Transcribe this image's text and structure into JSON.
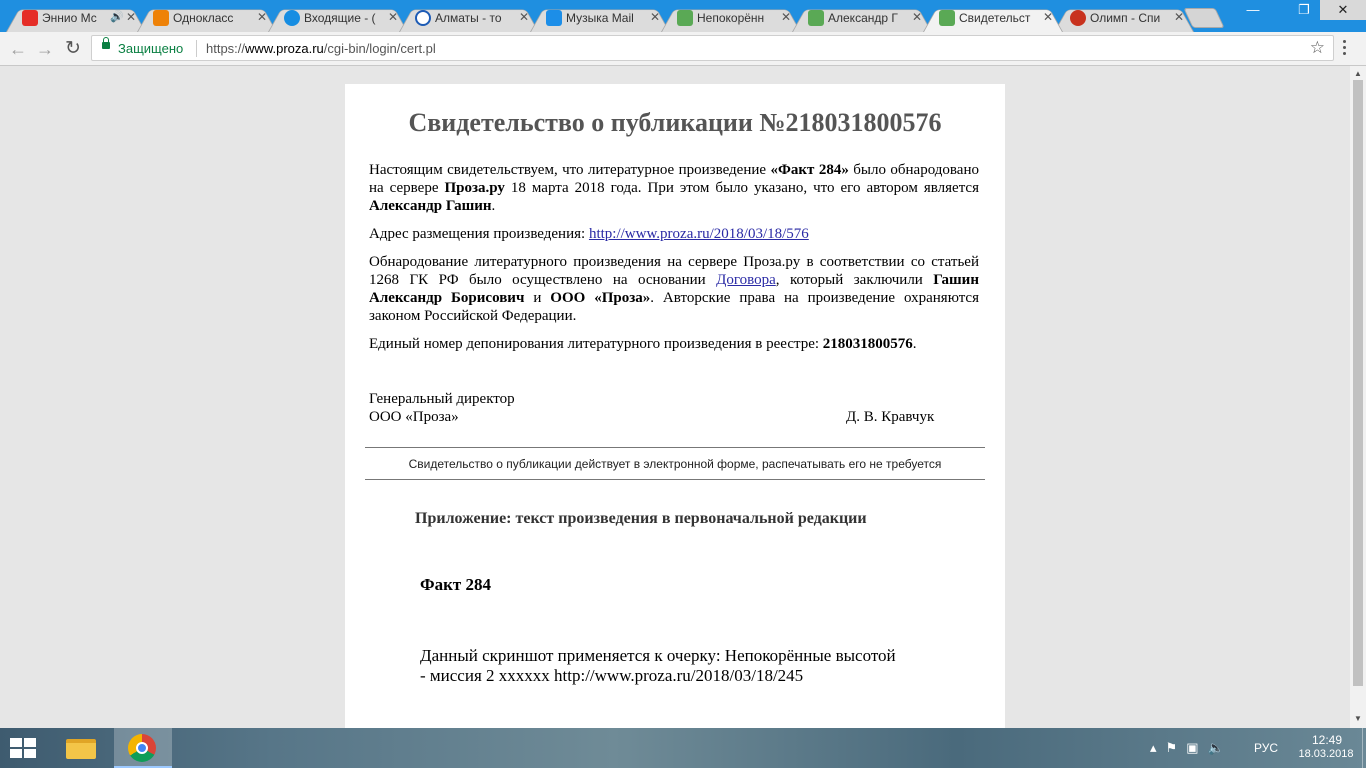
{
  "tabs": [
    {
      "title": "Эннио Мс",
      "favicon_color": "#e52d27",
      "icon": "youtube-icon"
    },
    {
      "title": "Однокласс",
      "favicon_color": "#ee8208",
      "icon": "odnoklassniki-icon"
    },
    {
      "title": "Входящие - (",
      "favicon_color": "#168de2",
      "icon": "mail-icon"
    },
    {
      "title": "Алматы - то",
      "favicon_color": "#1d5bb5",
      "icon": "clock-icon"
    },
    {
      "title": "Музыка Mail",
      "favicon_color": "#1c8ee8",
      "icon": "music-icon"
    },
    {
      "title": "Непокорённ",
      "favicon_color": "#5aa955",
      "icon": "proza-icon"
    },
    {
      "title": "Александр Г",
      "favicon_color": "#5aa955",
      "icon": "proza-icon"
    },
    {
      "title": "Свидетельст",
      "favicon_color": "#5aa955",
      "icon": "proza-icon"
    },
    {
      "title": "Олимп - Спи",
      "favicon_color": "#c8321e",
      "icon": "olimp-icon"
    }
  ],
  "toolbar": {
    "secure_label": "Защищено",
    "url_prefix": "https://",
    "url_host": "www.proza.ru",
    "url_path": "/cgi-bin/login/cert.pl"
  },
  "certificate": {
    "title": "Свидетельство о публикации №218031800576",
    "p1": {
      "t1": "Настоящим свидетельствуем, что литературное произведение ",
      "work": "«Факт 284»",
      "t2": " было обнародовано на сервере ",
      "server": "Проза.ру",
      "t3": " 18 марта 2018 года. При этом было указано, что его автором является ",
      "author": "Александр Гашин",
      "t4": "."
    },
    "p2": {
      "label": "Адрес размещения произведения: ",
      "link": "http://www.proza.ru/2018/03/18/576"
    },
    "p3": {
      "t1": "Обнародование литературного произведения на сервере Проза.ру в соответствии со статьей 1268 ГК РФ было осуществлено на основании ",
      "link": "Договора",
      "t2": ", который заключили ",
      "party1": "Гашин Александр Борисович",
      "t3": " и ",
      "party2": "ООО «Проза»",
      "t4": ". Авторские права на произведение охраняются законом Российской Федерации."
    },
    "p4": {
      "label": "Единый номер депонирования литературного произведения в реестре: ",
      "number": "218031800576",
      "end": "."
    },
    "signature": {
      "position": "Генеральный директор",
      "company": "ООО «Проза»",
      "name": "Д. В. Кравчук"
    },
    "note": "Свидетельство о публикации действует в электронной форме, распечатывать его не требуется",
    "appendix_title": "Приложение: текст произведения в первоначальной редакции",
    "work_title": "Факт 284",
    "work_line1": "Данный скриншот применяется к очерку: Непокорённые высотой",
    "work_line2": "- миссия 2 хххххх http://www.proza.ru/2018/03/18/245"
  },
  "taskbar": {
    "lang": "РУС",
    "time": "12:49",
    "date": "18.03.2018"
  }
}
